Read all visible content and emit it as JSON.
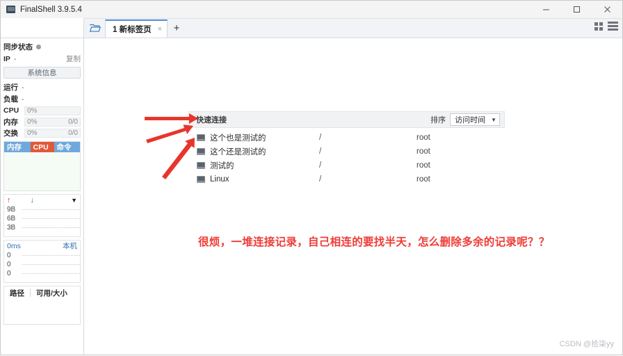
{
  "window": {
    "title": "FinalShell 3.9.5.4",
    "icon": "app-icon",
    "minimize": "–",
    "maximize": "□",
    "close": "×"
  },
  "tabbar": {
    "folder_icon": "folder-open-icon",
    "tab_label": "1 新标签页",
    "tab_close": "×",
    "add_tab": "+",
    "view_grid_icon": "grid-view-icon",
    "view_list_icon": "list-view-icon"
  },
  "sidebar": {
    "sync_status_label": "同步状态",
    "ip_label": "IP",
    "ip_value": "-",
    "copy_link": "复制",
    "sysinfo_button": "系统信息",
    "uptime_label": "运行",
    "uptime_value": "-",
    "load_label": "负载",
    "load_value": "-",
    "meters": [
      {
        "name": "CPU",
        "percent": "0%",
        "detail": ""
      },
      {
        "name": "内存",
        "percent": "0%",
        "detail": "0/0"
      },
      {
        "name": "交换",
        "percent": "0%",
        "detail": "0/0"
      }
    ],
    "process_columns": [
      "内存",
      "CPU",
      "命令"
    ],
    "network": {
      "upload_icon": "upload-arrow-icon",
      "download_icon": "download-arrow-icon",
      "collapse_icon": "caret-down-icon",
      "scale": [
        "9B",
        "6B",
        "3B"
      ]
    },
    "ping": {
      "latency": "0ms",
      "host": "本机",
      "scale": [
        "0",
        "0",
        "0"
      ]
    },
    "disk": {
      "path_header": "路径",
      "size_header": "可用/大小"
    }
  },
  "main": {
    "quick_connect": {
      "title": "快速连接",
      "sort_label": "排序",
      "sort_value": "访问时间",
      "sort_caret": "▼"
    },
    "connections": [
      {
        "name": "这个也是测试的",
        "path": "/",
        "user": "root"
      },
      {
        "name": "这个还是测试的",
        "path": "/",
        "user": "root"
      },
      {
        "name": "测试的",
        "path": "/",
        "user": "root"
      },
      {
        "name": "Linux",
        "path": "/",
        "user": "root"
      }
    ],
    "annotation": "很烦，一堆连接记录，自己相连的要找半天，怎么删除多余的记录呢？？",
    "annotation_color": "#ef3b36",
    "watermark": "CSDN @拾柒yy"
  }
}
